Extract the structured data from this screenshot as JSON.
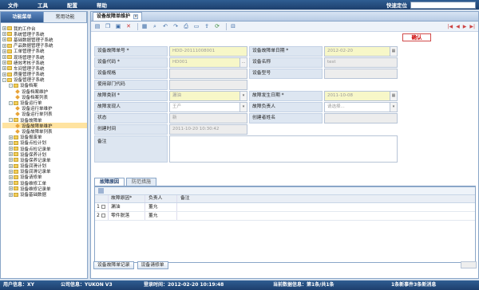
{
  "menu": {
    "items": [
      "文件",
      "工具",
      "配置",
      "帮助"
    ],
    "locate_label": "快速定位",
    "locate_value": ""
  },
  "sidebar": {
    "tabs": [
      "功能菜单",
      "常用功能"
    ],
    "tree": [
      {
        "label": "我的工作台",
        "type": "folder",
        "toggle": "+"
      },
      {
        "label": "系统管理子系统",
        "type": "folder",
        "toggle": "+"
      },
      {
        "label": "基础数据管理子系统",
        "type": "folder",
        "toggle": "+"
      },
      {
        "label": "产品数据管理子系统",
        "type": "folder",
        "toggle": "+"
      },
      {
        "label": "工单管理子系统",
        "type": "folder",
        "toggle": "+"
      },
      {
        "label": "现场管理子系统",
        "type": "folder",
        "toggle": "+"
      },
      {
        "label": "绩效考核子系统",
        "type": "folder",
        "toggle": "+"
      },
      {
        "label": "车间管理子系统",
        "type": "folder",
        "toggle": "+"
      },
      {
        "label": "质量管理子系统",
        "type": "folder",
        "toggle": "+"
      },
      {
        "label": "设备管理子系统",
        "type": "folder",
        "toggle": "-"
      },
      {
        "label": "设备档案",
        "type": "folder",
        "toggle": "-"
      },
      {
        "label": "设备档案维护",
        "type": "leaf",
        "toggle": ""
      },
      {
        "label": "设备档案列表",
        "type": "leaf",
        "toggle": ""
      },
      {
        "label": "设备运行单",
        "type": "folder",
        "toggle": "-"
      },
      {
        "label": "设备运行单维护",
        "type": "leaf",
        "toggle": ""
      },
      {
        "label": "设备运行单列表",
        "type": "leaf",
        "toggle": ""
      },
      {
        "label": "设备故障单",
        "type": "folder",
        "toggle": "-"
      },
      {
        "label": "设备故障单维护",
        "type": "leaf",
        "toggle": "",
        "selected": true
      },
      {
        "label": "设备故障单列表",
        "type": "leaf",
        "toggle": ""
      },
      {
        "label": "设备报废单",
        "type": "folder",
        "toggle": "+"
      },
      {
        "label": "设备点检计划",
        "type": "folder",
        "toggle": "+"
      },
      {
        "label": "设备点检记录单",
        "type": "folder",
        "toggle": "+"
      },
      {
        "label": "设备保养计划",
        "type": "folder",
        "toggle": "+"
      },
      {
        "label": "设备保养记录单",
        "type": "folder",
        "toggle": "+"
      },
      {
        "label": "设备润滑计划",
        "type": "folder",
        "toggle": "+"
      },
      {
        "label": "设备润滑记录单",
        "type": "folder",
        "toggle": "+"
      },
      {
        "label": "设备请修单",
        "type": "folder",
        "toggle": "+"
      },
      {
        "label": "设备维修工单",
        "type": "folder",
        "toggle": "+"
      },
      {
        "label": "设备维修记录单",
        "type": "folder",
        "toggle": "+"
      },
      {
        "label": "设备基础数据",
        "type": "folder",
        "toggle": "+"
      }
    ]
  },
  "main": {
    "tab_title": "设备故障单维护",
    "confirm_label": "确认",
    "form": {
      "fault_no_label": "设备故障单号 *",
      "fault_no_value": "HDD-20111008001",
      "fault_date_label": "设备故障单日期 *",
      "fault_date_value": "2012-02-20",
      "equip_code_label": "设备代码 *",
      "equip_code_value": "HD001",
      "equip_name_label": "设备名称",
      "equip_name_value": "test",
      "equip_spec_label": "设备规格",
      "equip_spec_value": "",
      "equip_model_label": "设备型号",
      "equip_model_value": "",
      "dept_label": "使用部门代码",
      "dept_value": "",
      "fault_type_label": "故障类别 *",
      "fault_type_value": "漏油",
      "occur_date_label": "故障发生日期 *",
      "occur_date_value": "2011-10-08",
      "finder_label": "故障发现人",
      "finder_value": "王产",
      "owner_label": "故障负责人",
      "owner_value": "请选择...",
      "status_label": "状态",
      "status_value": "新",
      "creator_label": "创建者姓名",
      "creator_value": "",
      "created_time_label": "创建时间",
      "created_time_value": "2011-10-20 10:30:42",
      "remark_label": "备注",
      "remark_value": ""
    },
    "bottom_tabs": [
      "故障原因",
      "防范措施"
    ],
    "grid": {
      "columns": [
        "故障原因*",
        "负责人",
        "备注"
      ],
      "rows": [
        {
          "no": "1",
          "reason": "漏油",
          "owner": "董允",
          "remark": ""
        },
        {
          "no": "2",
          "reason": "零件脱落",
          "owner": "董允",
          "remark": ""
        }
      ]
    },
    "footer_buttons": [
      "设备故障单记录",
      "设备请修单"
    ]
  },
  "status": {
    "user": "用户信息：XY",
    "company": "公司信息：YUKON V3",
    "login_time": "登录时间：2012-02-20 10:19:48",
    "records": "当前数据信息：第1条/共1条",
    "messages": "1条新事件3条新消息"
  }
}
